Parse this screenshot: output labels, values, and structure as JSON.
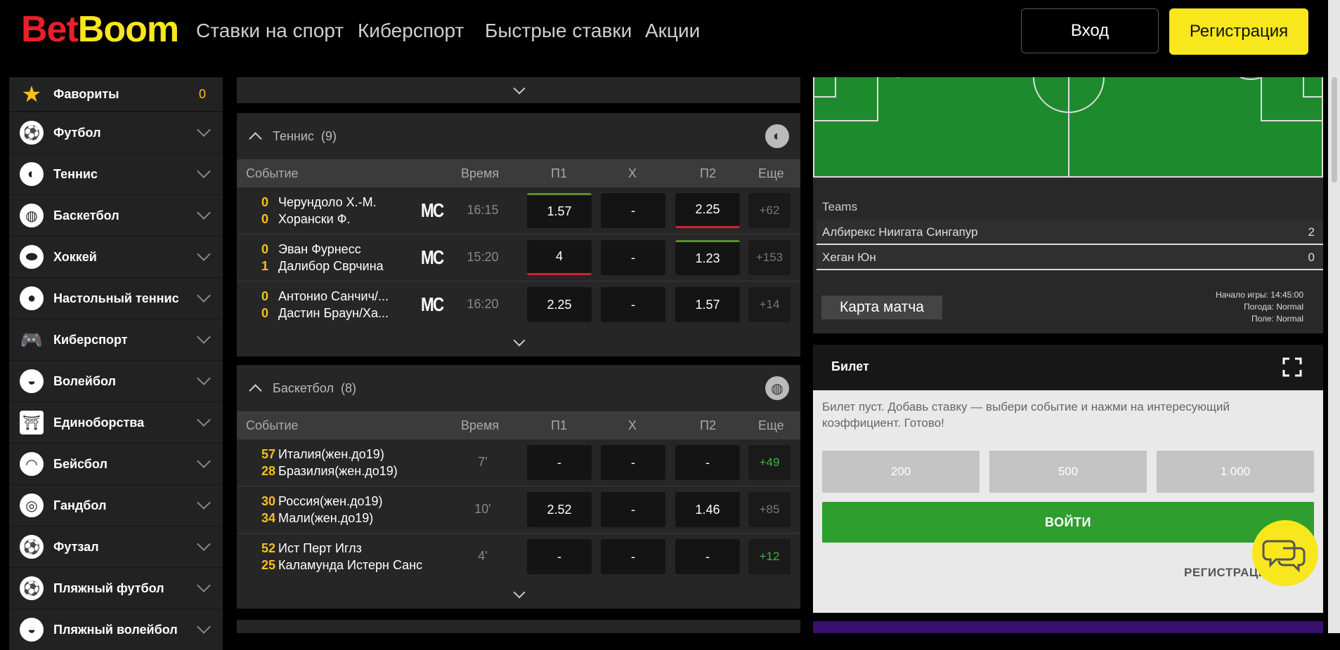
{
  "header": {
    "logo_part1": "Bet",
    "logo_part2": "Boom",
    "nav": [
      "Ставки на спорт",
      "Киберспорт",
      "Быстрые ставки",
      "Акции"
    ],
    "login_label": "Вход",
    "register_label": "Регистрация"
  },
  "sidebar": {
    "items": [
      {
        "label": "Фавориты",
        "icon": "star-icon",
        "count": "0"
      },
      {
        "label": "Футбол",
        "icon": "soccer-ball-icon"
      },
      {
        "label": "Теннис",
        "icon": "tennis-ball-icon"
      },
      {
        "label": "Баскетбол",
        "icon": "basketball-icon"
      },
      {
        "label": "Хоккей",
        "icon": "hockey-puck-icon"
      },
      {
        "label": "Настольный теннис",
        "icon": "table-tennis-icon"
      },
      {
        "label": "Киберспорт",
        "icon": "gamepad-icon"
      },
      {
        "label": "Волейбол",
        "icon": "volleyball-icon"
      },
      {
        "label": "Единоборства",
        "icon": "martial-arts-icon"
      },
      {
        "label": "Бейсбол",
        "icon": "baseball-icon"
      },
      {
        "label": "Гандбол",
        "icon": "handball-icon"
      },
      {
        "label": "Футзал",
        "icon": "futsal-ball-icon"
      },
      {
        "label": "Пляжный футбол",
        "icon": "beach-soccer-icon"
      },
      {
        "label": "Пляжный волейбол",
        "icon": "beach-volleyball-icon"
      }
    ]
  },
  "table_headers": {
    "event": "Событие",
    "time": "Время",
    "p1": "П1",
    "x": "Х",
    "p2": "П2",
    "more": "Еще"
  },
  "tennis": {
    "title": "Теннис",
    "count": "(9)",
    "rows": [
      {
        "s1": "0",
        "s2": "0",
        "t1": "Черундоло Х.-М.",
        "t2": "Хорански Ф.",
        "badge": "MC",
        "time": "16:15",
        "p1": "1.57",
        "x": "-",
        "p2": "2.25",
        "more": "+62"
      },
      {
        "s1": "0",
        "s2": "1",
        "t1": "Эван Фурнесс",
        "t2": "Далибор Сврчина",
        "badge": "MC",
        "time": "15:20",
        "p1": "4",
        "x": "-",
        "p2": "1.23",
        "more": "+153"
      },
      {
        "s1": "0",
        "s2": "0",
        "t1": "Антонио Санчич/...",
        "t2": "Дастин Браун/Ха...",
        "badge": "MC",
        "time": "16:20",
        "p1": "2.25",
        "x": "-",
        "p2": "1.57",
        "more": "+14"
      }
    ]
  },
  "basketball": {
    "title": "Баскетбол",
    "count": "(8)",
    "rows": [
      {
        "s1": "57",
        "s2": "28",
        "t1": "Италия(жен.до19)",
        "t2": "Бразилия(жен.до19)",
        "time": "7'",
        "p1": "-",
        "x": "-",
        "p2": "-",
        "more": "+49"
      },
      {
        "s1": "30",
        "s2": "34",
        "t1": "Россия(жен.до19)",
        "t2": "Мали(жен.до19)",
        "time": "10'",
        "p1": "2.52",
        "x": "-",
        "p2": "1.46",
        "more": "+85"
      },
      {
        "s1": "52",
        "s2": "25",
        "t1": "Ист Перт Иглз",
        "t2": "Каламунда Истерн Санс",
        "time": "4'",
        "p1": "-",
        "x": "-",
        "p2": "-",
        "more": "+12"
      }
    ]
  },
  "match": {
    "teams_header": "Teams",
    "team1": "Албирекс Ниигата Сингапур",
    "team1_score": "2",
    "team2": "Хеган Юн",
    "team2_score": "0",
    "map_button": "Карта матча",
    "start": "Начало игры: 14:45:00",
    "weather": "Погода: Normal",
    "pitch": "Поле: Normal"
  },
  "ticket": {
    "title": "Билет",
    "empty_text": "Билет пуст. Добавь ставку — выбери событие и нажми на интересующий коэффициент. Готово!",
    "amounts": [
      "200",
      "500",
      "1 000"
    ],
    "enter_label": "ВОЙТИ",
    "register_link": "РЕГИСТРАЦИЯ"
  },
  "colors": {
    "accent_yellow": "#f8e71c",
    "logo_red": "#e8202a",
    "green": "#2e9e2e",
    "up": "#5a8f2a",
    "down": "#d2232a"
  }
}
